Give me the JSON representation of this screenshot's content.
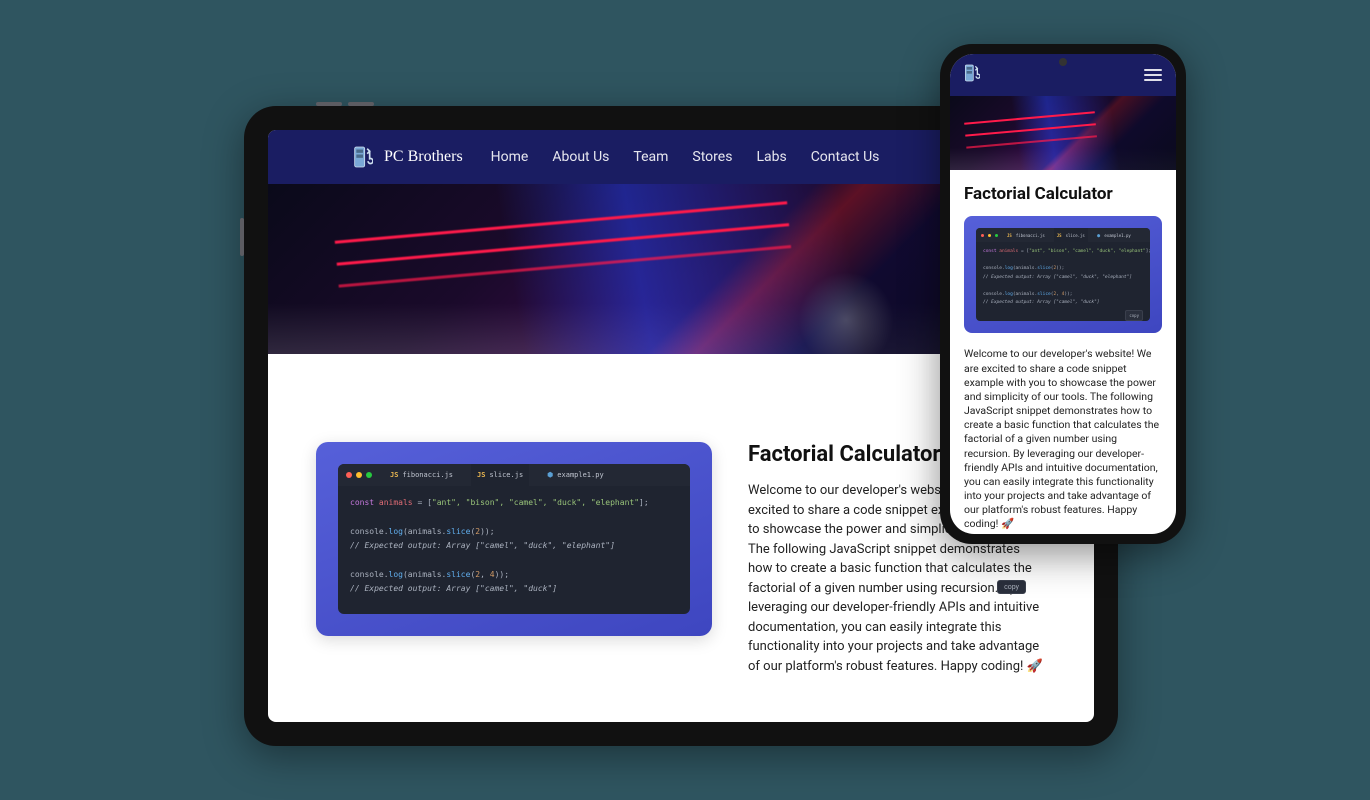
{
  "brand": {
    "name": "PC Brothers"
  },
  "nav": {
    "items": [
      "Home",
      "About Us",
      "Team",
      "Stores",
      "Labs",
      "Contact Us"
    ]
  },
  "article": {
    "title": "Factorial Calculator",
    "body_pre": "Welcome to our developer's website! We are excited to share a code snippet example with you to showcase the power and simplicity of our tools. The following JavaScript snippet demonstrates how to create a basic function that calculates the factorial of a given number using recursion. By leveraging our developer-friendly APIs and intuitive documentation, you can easily integrate this functionality into your projects and take advantage of our platform's robust features. Happy coding! ",
    "rocket": "🚀"
  },
  "code": {
    "tabs": [
      {
        "lang": "JS",
        "file": "fibonacci.js"
      },
      {
        "lang": "JS",
        "file": "slice.js"
      },
      {
        "lang": "py",
        "file": "example1.py"
      }
    ],
    "copy_label": "copy",
    "line1_kw": "const",
    "line1_var": " animals ",
    "line1_op": "= [",
    "line1_strs": "\"ant\", \"bison\", \"camel\", \"duck\", \"elephant\"",
    "line1_end": "];",
    "line2_pre": "console.",
    "line2_fn": "log",
    "line2_mid": "(animals.",
    "line2_fn2": "slice",
    "line2_args": "(",
    "line2_num": "2",
    "line2_end": "));",
    "line3_cm": "// Expected output: Array [\"camel\", \"duck\", \"elephant\"]",
    "line4_pre": "console.",
    "line4_fn": "log",
    "line4_mid": "(animals.",
    "line4_fn2": "slice",
    "line4_args": "(",
    "line4_num1": "2",
    "line4_comma": ", ",
    "line4_num2": "4",
    "line4_end": "));",
    "line5_cm": "// Expected output: Array [\"camel\", \"duck\"]"
  }
}
